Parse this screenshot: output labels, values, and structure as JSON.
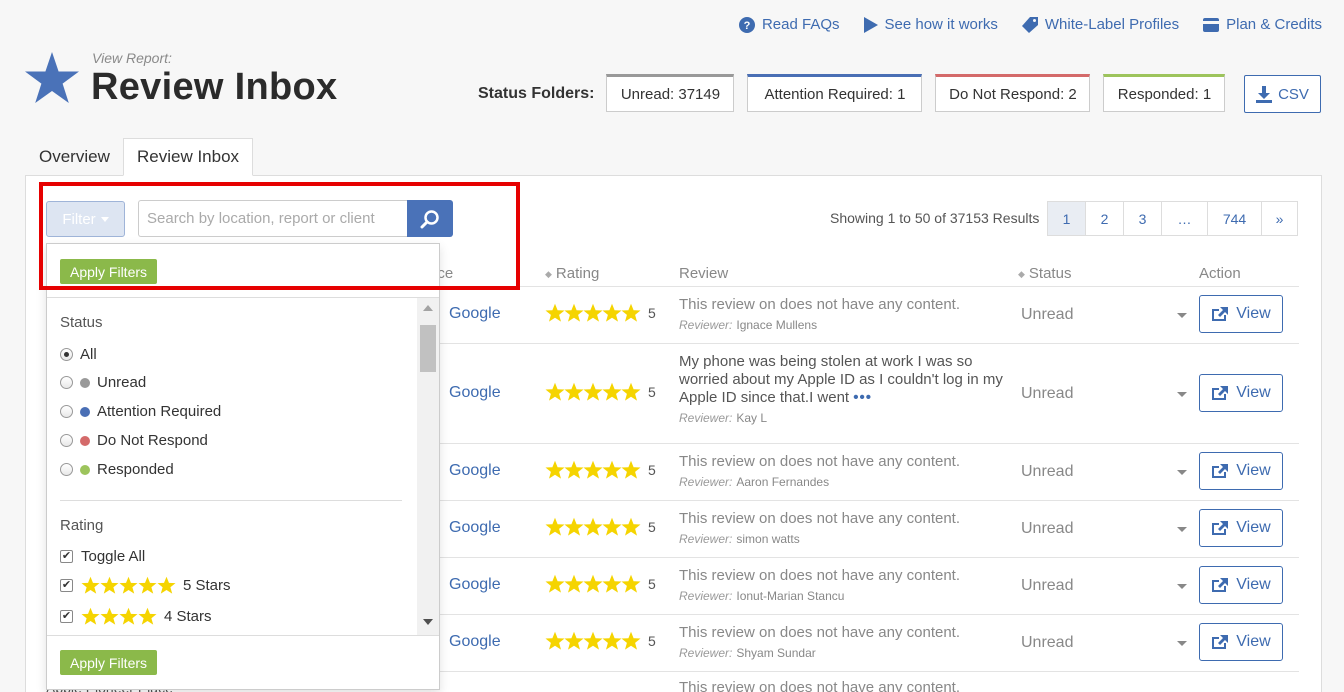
{
  "toplinks": [
    {
      "label": "Read FAQs",
      "icon": "question-circle-icon"
    },
    {
      "label": "See how it works",
      "icon": "play-icon"
    },
    {
      "label": "White-Label Profiles",
      "icon": "tag-icon"
    },
    {
      "label": "Plan & Credits",
      "icon": "credit-card-icon"
    }
  ],
  "header": {
    "subtitle": "View Report:",
    "title": "Review Inbox"
  },
  "status_folders": {
    "label": "Status Folders:",
    "unread": "Unread: 37149",
    "attention": "Attention Required: 1",
    "do_not_respond": "Do Not Respond: 2",
    "responded": "Responded: 1",
    "csv": "CSV"
  },
  "tabs": [
    "Overview",
    "Review Inbox"
  ],
  "filter": {
    "button": "Filter",
    "search_placeholder": "Search by location, report or client"
  },
  "results": {
    "showing": "Showing 1 to 50 of 37153 Results",
    "pages": [
      "1",
      "2",
      "3",
      "…",
      "744",
      "»"
    ]
  },
  "table": {
    "headers": {
      "source": "urce",
      "rating": "Rating",
      "review": "Review",
      "status": "Status",
      "action": "Action"
    },
    "rows": [
      {
        "source": "Google",
        "rating": "5",
        "review": "This review on does not have any content.",
        "reviewer_label": "Reviewer:",
        "reviewer": "Ignace Mullens",
        "status": "Unread",
        "action": "View"
      },
      {
        "source": "Google",
        "rating": "5",
        "review": "My phone was being stolen at work I was so worried about my Apple ID as I couldn't log in my Apple ID since that.I went",
        "more": "•••",
        "reviewer_label": "Reviewer:",
        "reviewer": "Kay L",
        "status": "Unread",
        "action": "View"
      },
      {
        "source": "Google",
        "rating": "5",
        "review": "This review on does not have any content.",
        "reviewer_label": "Reviewer:",
        "reviewer": "Aaron Fernandes",
        "status": "Unread",
        "action": "View"
      },
      {
        "source": "Google",
        "rating": "5",
        "review": "This review on does not have any content.",
        "reviewer_label": "Reviewer:",
        "reviewer": "simon watts",
        "status": "Unread",
        "action": "View"
      },
      {
        "source": "Google",
        "rating": "5",
        "review": "This review on does not have any content.",
        "reviewer_label": "Reviewer:",
        "reviewer": "Ionut-Marian Stancu",
        "status": "Unread",
        "action": "View"
      },
      {
        "source": "Google",
        "rating": "5",
        "review": "This review on does not have any content.",
        "reviewer_label": "Reviewer:",
        "reviewer": "Shyam Sundar",
        "status": "Unread",
        "action": "View"
      },
      {
        "review": "This review on does not have any content.",
        "location": "Apple Pioneer Place"
      }
    ]
  },
  "dropdown": {
    "apply": "Apply Filters",
    "status_title": "Status",
    "status_options": [
      "All",
      "Unread",
      "Attention Required",
      "Do Not Respond",
      "Responded"
    ],
    "status_selected": "All",
    "rating_title": "Rating",
    "toggle_all": "Toggle All",
    "rating_options": [
      "5 Stars",
      "4 Stars"
    ]
  },
  "colors": {
    "accent": "#3e6bb0",
    "unread": "#999999",
    "attention": "#4a6fb5",
    "do_not_respond": "#d46a6a",
    "responded": "#9dc45c",
    "apply_green": "#8bb94a",
    "highlight_red": "#e60000",
    "star": "#f5d400"
  }
}
